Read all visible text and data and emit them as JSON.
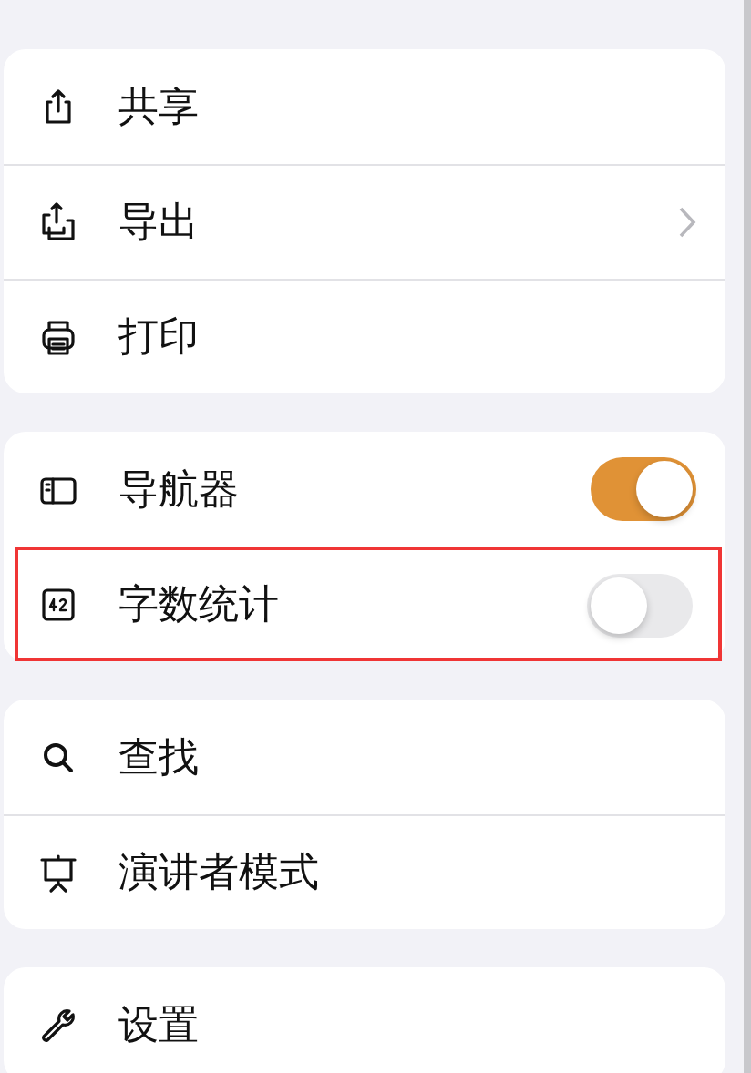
{
  "groups": [
    {
      "items": [
        {
          "label": "共享",
          "kind": "plain"
        },
        {
          "label": "导出",
          "kind": "chevron"
        },
        {
          "label": "打印",
          "kind": "plain"
        }
      ]
    },
    {
      "items": [
        {
          "label": "导航器",
          "kind": "toggle",
          "on": true,
          "highlighted": false
        },
        {
          "label": "字数统计",
          "kind": "toggle",
          "on": false,
          "highlighted": true
        }
      ]
    },
    {
      "items": [
        {
          "label": "查找",
          "kind": "plain"
        },
        {
          "label": "演讲者模式",
          "kind": "plain"
        }
      ]
    },
    {
      "items": [
        {
          "label": "设置",
          "kind": "plain"
        }
      ]
    }
  ]
}
